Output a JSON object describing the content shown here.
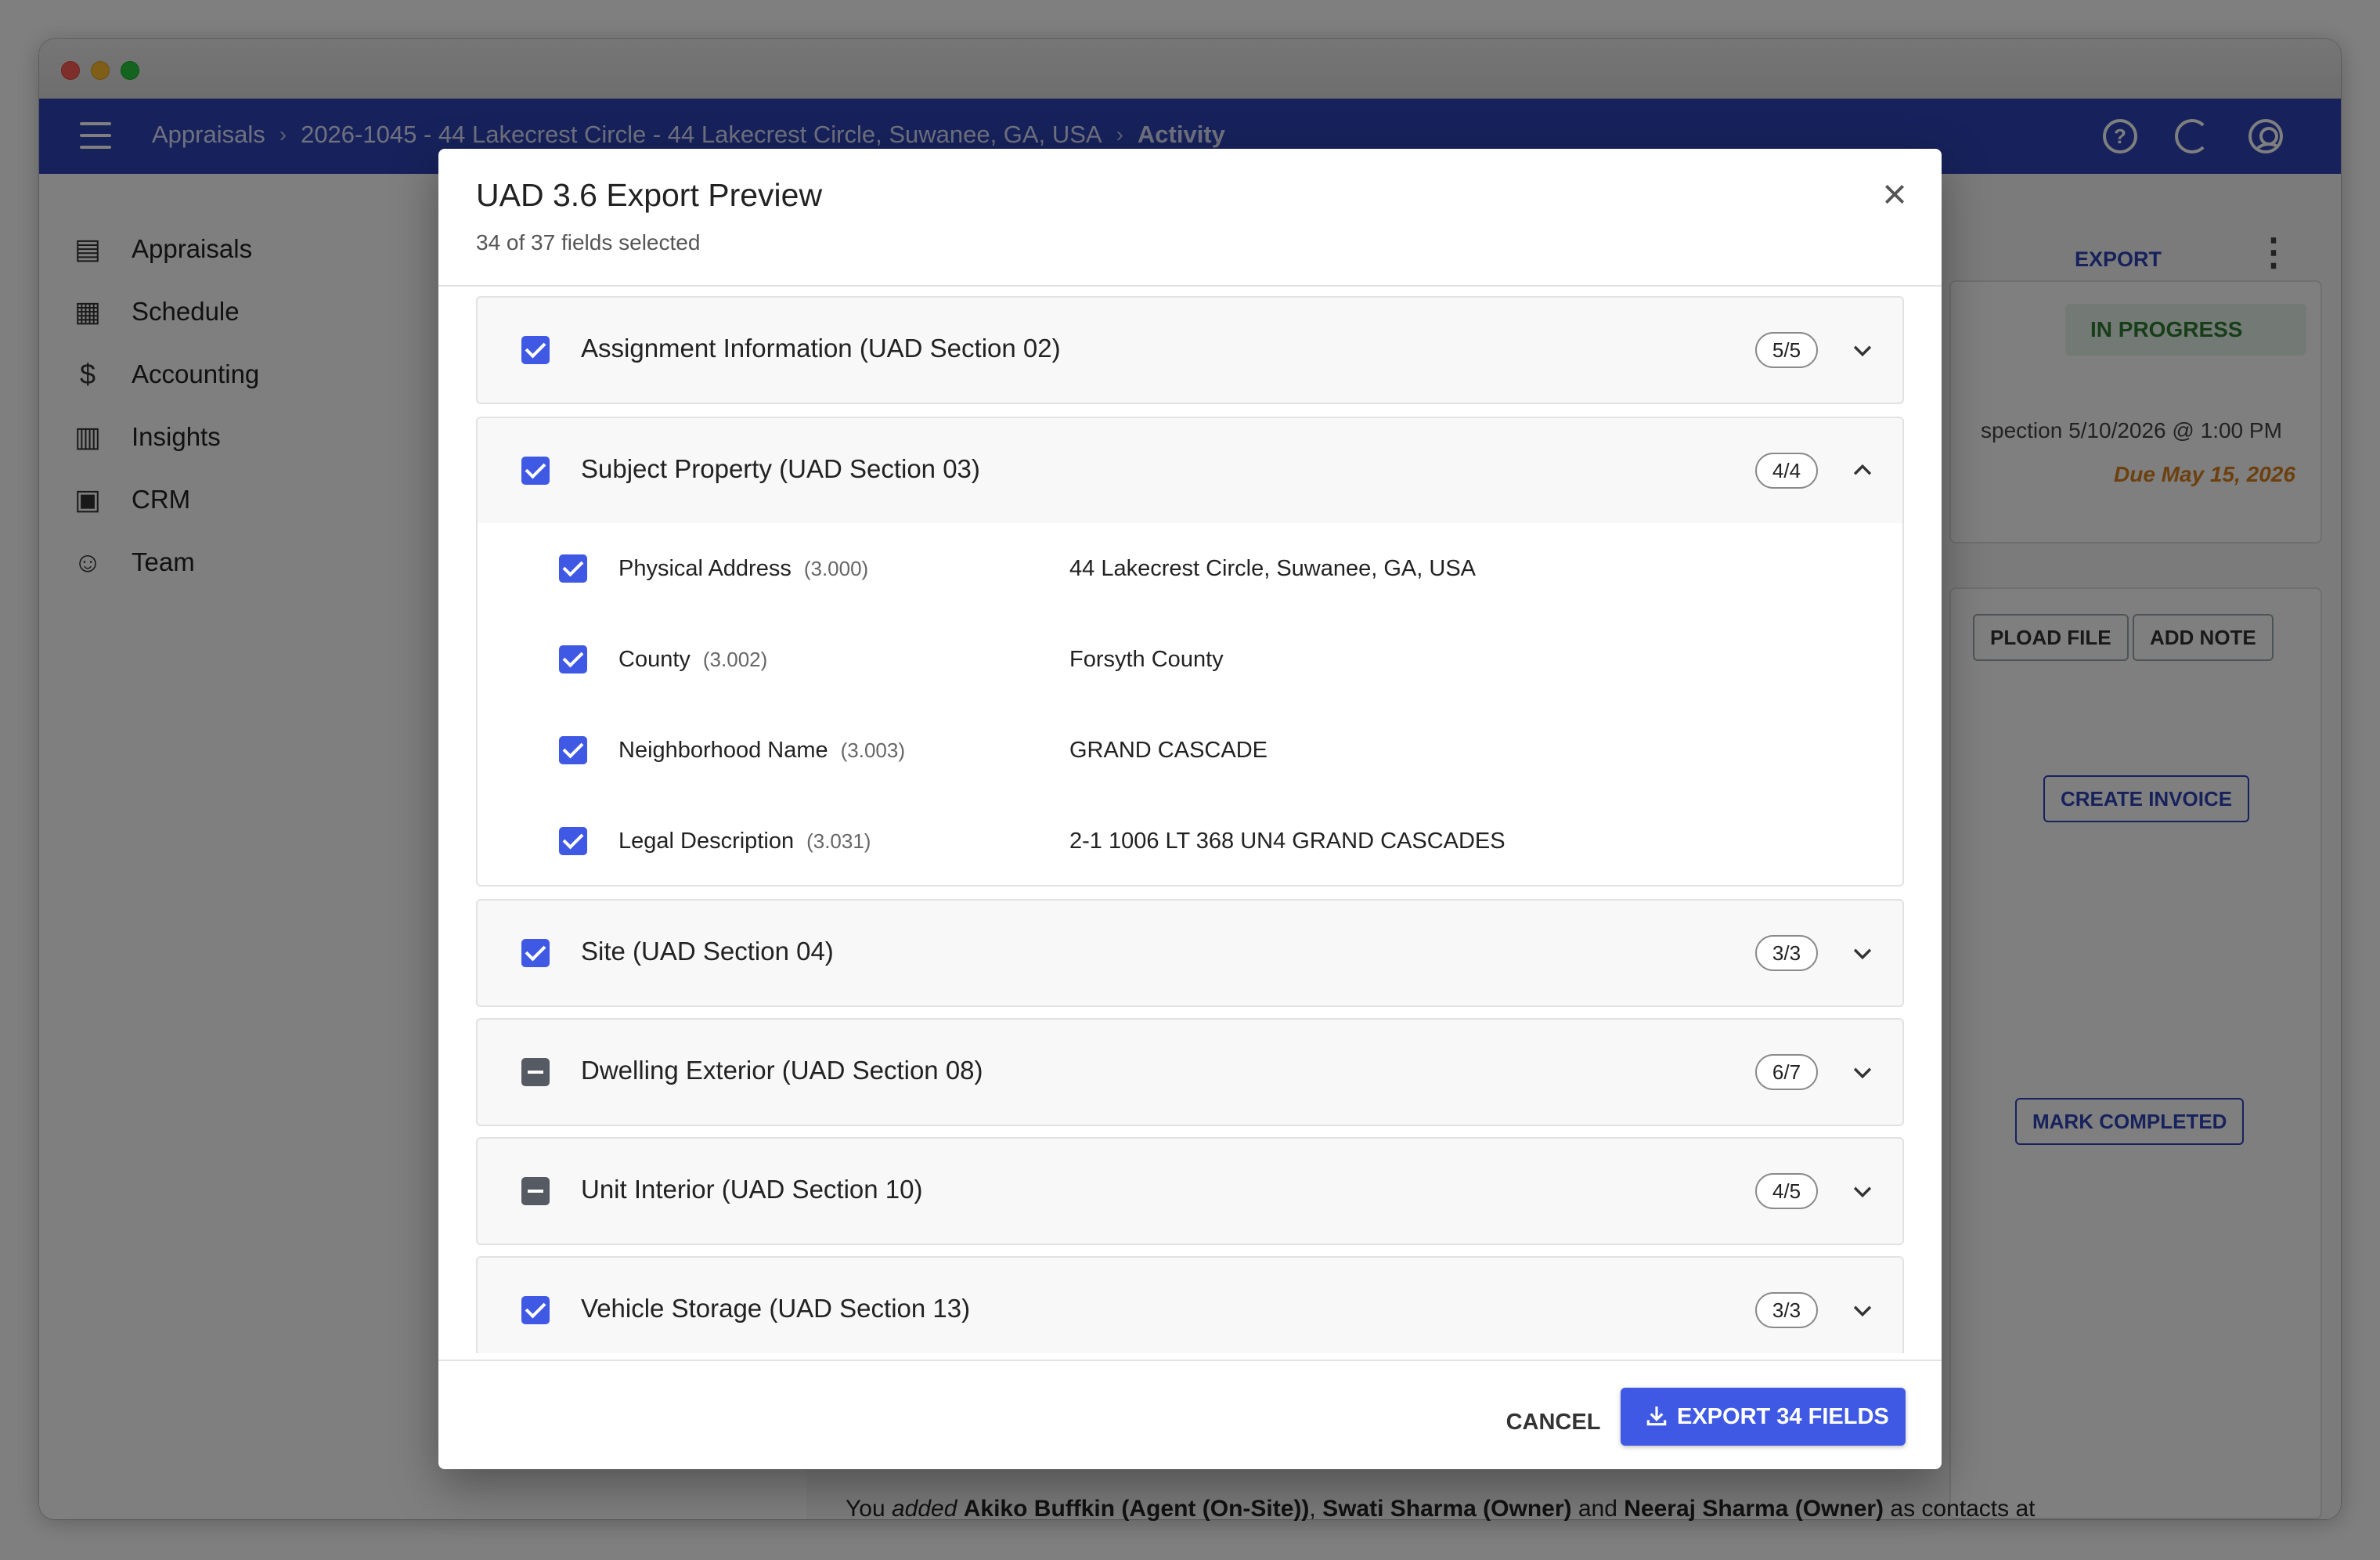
{
  "app": {
    "breadcrumb": [
      "Appraisals",
      "2026-1045 - 44 Lakecrest Circle - 44 Lakecrest Circle, Suwanee, GA, USA",
      "Activity"
    ],
    "breadcrumb_separator": "›",
    "icons": [
      "menu-icon",
      "help-icon",
      "refresh-icon",
      "account-icon"
    ]
  },
  "sidebar": {
    "items": [
      {
        "label": "Appraisals",
        "icon": "clipboard-icon"
      },
      {
        "label": "Schedule",
        "icon": "calendar-icon"
      },
      {
        "label": "Accounting",
        "icon": "dollar-icon"
      },
      {
        "label": "Insights",
        "icon": "bar-chart-icon"
      },
      {
        "label": "CRM",
        "icon": "briefcase-icon"
      },
      {
        "label": "Team",
        "icon": "people-icon"
      }
    ]
  },
  "background": {
    "export_label": "EXPORT",
    "status": "IN PROGRESS",
    "inspection": "spection 5/10/2026 @ 1:00 PM",
    "due": "Due May 15, 2026",
    "upload_file": "PLOAD FILE",
    "add_note": "ADD NOTE",
    "create_invoice": "CREATE INVOICE",
    "mark_completed": "MARK COMPLETED",
    "activity_prefix": "You",
    "activity_verb": "added",
    "activity_contact1": "Akiko Buffkin (Agent (On-Site))",
    "activity_sep1": ",",
    "activity_contact2": "Swati Sharma (Owner)",
    "activity_and": "and",
    "activity_contact3": "Neeraj Sharma (Owner)",
    "activity_suffix": "as contacts at"
  },
  "dialog": {
    "title": "UAD 3.6 Export Preview",
    "subtitle": "34 of 37 fields selected",
    "close_glyph": "×",
    "sections": [
      {
        "title": "Assignment Information (UAD Section 02)",
        "count": "5/5",
        "state": "checked",
        "expanded": false
      },
      {
        "title": "Subject Property (UAD Section 03)",
        "count": "4/4",
        "state": "checked",
        "expanded": true,
        "fields": [
          {
            "label": "Physical Address",
            "code": "(3.000)",
            "value": "44 Lakecrest Circle, Suwanee, GA, USA",
            "checked": true
          },
          {
            "label": "County",
            "code": "(3.002)",
            "value": "Forsyth County",
            "checked": true
          },
          {
            "label": "Neighborhood Name",
            "code": "(3.003)",
            "value": "GRAND CASCADE",
            "checked": true
          },
          {
            "label": "Legal Description",
            "code": "(3.031)",
            "value": "2-1 1006 LT 368 UN4 GRAND CASCADES",
            "checked": true
          }
        ]
      },
      {
        "title": "Site (UAD Section 04)",
        "count": "3/3",
        "state": "checked",
        "expanded": false
      },
      {
        "title": "Dwelling Exterior (UAD Section 08)",
        "count": "6/7",
        "state": "partial",
        "expanded": false
      },
      {
        "title": "Unit Interior (UAD Section 10)",
        "count": "4/5",
        "state": "partial",
        "expanded": false
      },
      {
        "title": "Vehicle Storage (UAD Section 13)",
        "count": "3/3",
        "state": "checked",
        "expanded": false
      }
    ],
    "cancel_label": "CANCEL",
    "export_label": "EXPORT 34 FIELDS"
  },
  "colors": {
    "appbar": "#2f44b8",
    "primary": "#3f59e4",
    "status_green": "#2e7d32",
    "due_orange": "#d9811e"
  }
}
